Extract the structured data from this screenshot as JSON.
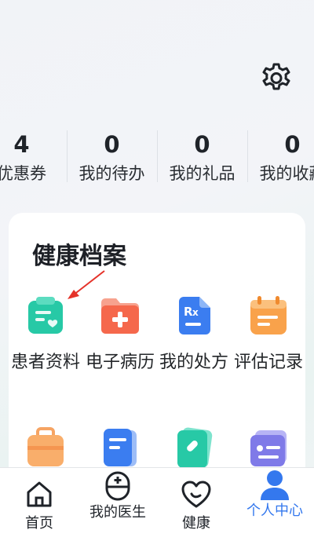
{
  "stats": [
    {
      "value": "4",
      "label": "优惠券"
    },
    {
      "value": "0",
      "label": "我的待办"
    },
    {
      "value": "0",
      "label": "我的礼品"
    },
    {
      "value": "0",
      "label": "我的收藏"
    }
  ],
  "health": {
    "title": "健康档案",
    "items": [
      {
        "label": "患者资料",
        "icon": "patient-info-icon",
        "color": "#27c9a6"
      },
      {
        "label": "电子病历",
        "icon": "medical-record-icon",
        "color": "#f5684c"
      },
      {
        "label": "我的处方",
        "icon": "prescription-icon",
        "color": "#3b7df0"
      },
      {
        "label": "评估记录",
        "icon": "assessment-record-icon",
        "color": "#f9a24b"
      }
    ]
  },
  "tabs": [
    {
      "label": "首页"
    },
    {
      "label": "我的医生"
    },
    {
      "label": "健康"
    },
    {
      "label": "个人中心"
    }
  ],
  "colors": {
    "accent": "#3478ee",
    "text": "#1f2329"
  }
}
